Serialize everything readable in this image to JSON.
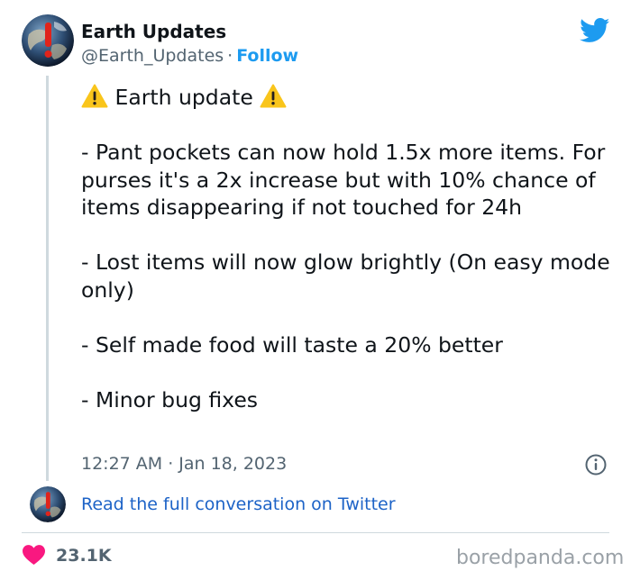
{
  "author": {
    "display_name": "Earth Updates",
    "handle": "@Earth_Updates",
    "separator": "·",
    "follow_label": "Follow"
  },
  "tweet": {
    "heading": "Earth update",
    "lines": [
      "- Pant pockets can now hold 1.5x more items. For purses it's a 2x increase but with 10% chance of items disappearing if not touched for 24h",
      "- Lost items will now glow brightly (On easy mode only)",
      "- Self made food will taste a 20% better",
      "- Minor bug fixes"
    ],
    "time": "12:27 AM",
    "separator": "·",
    "date": "Jan 18, 2023"
  },
  "footer": {
    "read_link": "Read the full conversation on Twitter",
    "like_count": "23.1K",
    "watermark": "boredpanda.com"
  },
  "colors": {
    "accent": "#1d9bf0",
    "heart": "#f91880",
    "muted_text": "#536471",
    "divider": "#cfd9de"
  },
  "icons": [
    "earth-avatar-icon",
    "twitter-bird-icon",
    "warning-icon",
    "info-icon",
    "heart-icon"
  ]
}
